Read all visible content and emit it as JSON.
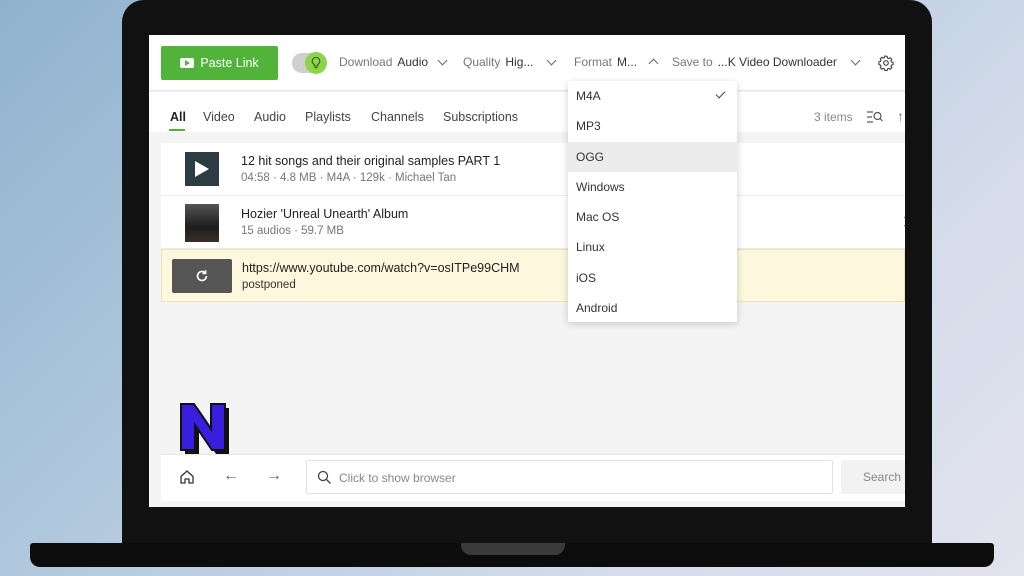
{
  "toolbar": {
    "paste_link_label": "Paste Link",
    "download_label": "Download",
    "download_value": "Audio",
    "quality_label": "Quality",
    "quality_value": "Hig...",
    "format_label": "Format",
    "format_value": "M...",
    "save_to_label": "Save to",
    "save_to_value": "...K Video Downloader"
  },
  "tabs": [
    {
      "label": "All",
      "active": true
    },
    {
      "label": "Video"
    },
    {
      "label": "Audio"
    },
    {
      "label": "Playlists"
    },
    {
      "label": "Channels"
    },
    {
      "label": "Subscriptions"
    }
  ],
  "items_count": "3 items",
  "list": [
    {
      "title": "12 hit songs and their original samples PART 1",
      "meta": "04:58 · 4.8 MB · M4A · 129k · Michael Tan"
    },
    {
      "title": "Hozier 'Unreal Unearth' Album",
      "meta": "15 audios · 59.7 MB"
    },
    {
      "title": "https://www.youtube.com/watch?v=osITPe99CHM",
      "meta": "postponed"
    }
  ],
  "format_options": [
    {
      "label": "M4A",
      "selected": true
    },
    {
      "label": "MP3"
    },
    {
      "label": "OGG",
      "hovered": true
    },
    {
      "label": "Windows"
    },
    {
      "label": "Mac OS"
    },
    {
      "label": "Linux"
    },
    {
      "label": "iOS"
    },
    {
      "label": "Android"
    }
  ],
  "browser_bar": {
    "placeholder": "Click to show browser",
    "search_label": "Search"
  },
  "colors": {
    "accent_green": "#52b33a",
    "postponed_bg": "#fdf7dd",
    "logo_fill": "#3a1ee0"
  },
  "icons": [
    "youtube-icon",
    "bulb-icon",
    "gear-icon",
    "list-search-icon",
    "sort-icon",
    "play-icon",
    "refresh-icon",
    "home-icon",
    "back-arrow-icon",
    "forward-arrow-icon",
    "search-icon",
    "check-icon"
  ]
}
